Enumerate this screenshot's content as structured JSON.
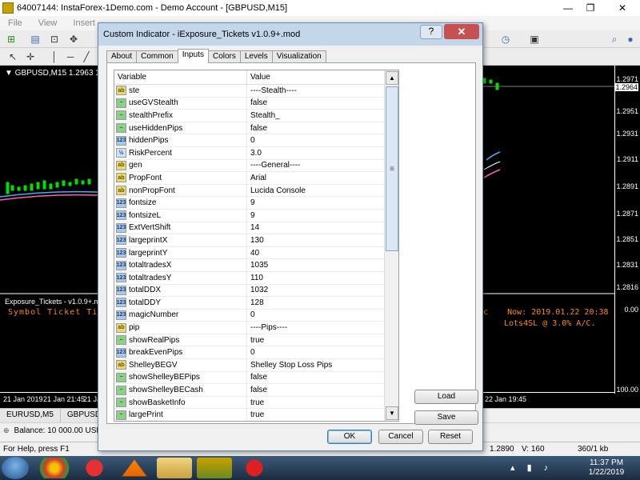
{
  "main_window": {
    "title": "64007144: InstaForex-1Demo.com - Demo Account - [GBPUSD,M15]",
    "controls": [
      "—",
      "❐",
      "✕"
    ],
    "menu": [
      "File",
      "View",
      "Insert"
    ]
  },
  "chart": {
    "label": "▼ GBPUSD,M15  1.2963  1.2966  1.",
    "price_ticks": [
      "1.2971",
      "1.2964",
      "1.2951",
      "1.2931",
      "1.2911",
      "1.2891",
      "1.2871",
      "1.2851",
      "1.2831",
      "1.2816",
      "0.00",
      "100.00"
    ],
    "current_price": "1.2964",
    "time_ticks": [
      "21 Jan 2019",
      "21 Jan 21:45",
      "21 Jan",
      "22 Jan 19:45"
    ],
    "subwindow_label": "Exposure_Tickets - v1.0.9+.mod",
    "subwindow_columns": "Symbol  Ticket   Ti",
    "subwindow_now": "c    Now: 2019.01.22 20:38",
    "subwindow_lots": "Lots4SL @ 3.0% A/C.",
    "tabs": [
      "EURUSD,M5",
      "GBPUSD,M"
    ]
  },
  "balance_text": "Balance: 10 000.00 USD",
  "status": {
    "help": "For Help, press F1",
    "price": "1.2890",
    "volume": "V: 160",
    "traffic": "360/1 kb"
  },
  "taskbar": {
    "time": "11:37 PM",
    "date": "1/22/2019"
  },
  "dialog": {
    "title": "Custom Indicator - iExposure_Tickets v1.0.9+.mod",
    "help_label": "?",
    "close_label": "✕",
    "tabs": [
      "About",
      "Common",
      "Inputs",
      "Colors",
      "Levels",
      "Visualization"
    ],
    "active_tab": "Inputs",
    "grid": {
      "col_variable": "Variable",
      "col_value": "Value",
      "rows": [
        {
          "type": "string",
          "icon": "ab",
          "name": "ste",
          "value": "----Stealth----"
        },
        {
          "type": "bool",
          "icon": "~",
          "name": "useGVStealth",
          "value": "false"
        },
        {
          "type": "bool",
          "icon": "~",
          "name": "stealthPrefix",
          "value": "Stealth_"
        },
        {
          "type": "bool",
          "icon": "~",
          "name": "useHiddenPips",
          "value": "false"
        },
        {
          "type": "int",
          "icon": "123",
          "name": "hiddenPips",
          "value": "0"
        },
        {
          "type": "double",
          "icon": "½",
          "name": "RiskPercent",
          "value": "3.0"
        },
        {
          "type": "string",
          "icon": "ab",
          "name": "gen",
          "value": "----General----"
        },
        {
          "type": "string",
          "icon": "ab",
          "name": "PropFont",
          "value": "Arial"
        },
        {
          "type": "string",
          "icon": "ab",
          "name": "nonPropFont",
          "value": "Lucida Console"
        },
        {
          "type": "int",
          "icon": "123",
          "name": "fontsize",
          "value": "9"
        },
        {
          "type": "int",
          "icon": "123",
          "name": "fontsizeL",
          "value": "9"
        },
        {
          "type": "int",
          "icon": "123",
          "name": "ExtVertShift",
          "value": "14"
        },
        {
          "type": "int",
          "icon": "123",
          "name": "largeprintX",
          "value": "130"
        },
        {
          "type": "int",
          "icon": "123",
          "name": "largeprintY",
          "value": "40"
        },
        {
          "type": "int",
          "icon": "123",
          "name": "totaltradesX",
          "value": "1035"
        },
        {
          "type": "int",
          "icon": "123",
          "name": "totaltradesY",
          "value": "110"
        },
        {
          "type": "int",
          "icon": "123",
          "name": "totalDDX",
          "value": "1032"
        },
        {
          "type": "int",
          "icon": "123",
          "name": "totalDDY",
          "value": "128"
        },
        {
          "type": "int",
          "icon": "123",
          "name": "magicNumber",
          "value": "0"
        },
        {
          "type": "string",
          "icon": "ab",
          "name": "pip",
          "value": "----Pips----"
        },
        {
          "type": "bool",
          "icon": "~",
          "name": "showRealPips",
          "value": "true"
        },
        {
          "type": "int",
          "icon": "123",
          "name": "breakEvenPips",
          "value": "0"
        },
        {
          "type": "string",
          "icon": "ab",
          "name": "ShelleyBEGV",
          "value": "Shelley Stop Loss Pips"
        },
        {
          "type": "bool",
          "icon": "~",
          "name": "showShelleyBEPips",
          "value": "false"
        },
        {
          "type": "bool",
          "icon": "~",
          "name": "showShelleyBECash",
          "value": "false"
        },
        {
          "type": "bool",
          "icon": "~",
          "name": "showBasketInfo",
          "value": "true"
        },
        {
          "type": "bool",
          "icon": "~",
          "name": "largePrint",
          "value": "true"
        }
      ]
    },
    "buttons": {
      "load": "Load",
      "save": "Save",
      "ok": "OK",
      "cancel": "Cancel",
      "reset": "Reset"
    }
  }
}
